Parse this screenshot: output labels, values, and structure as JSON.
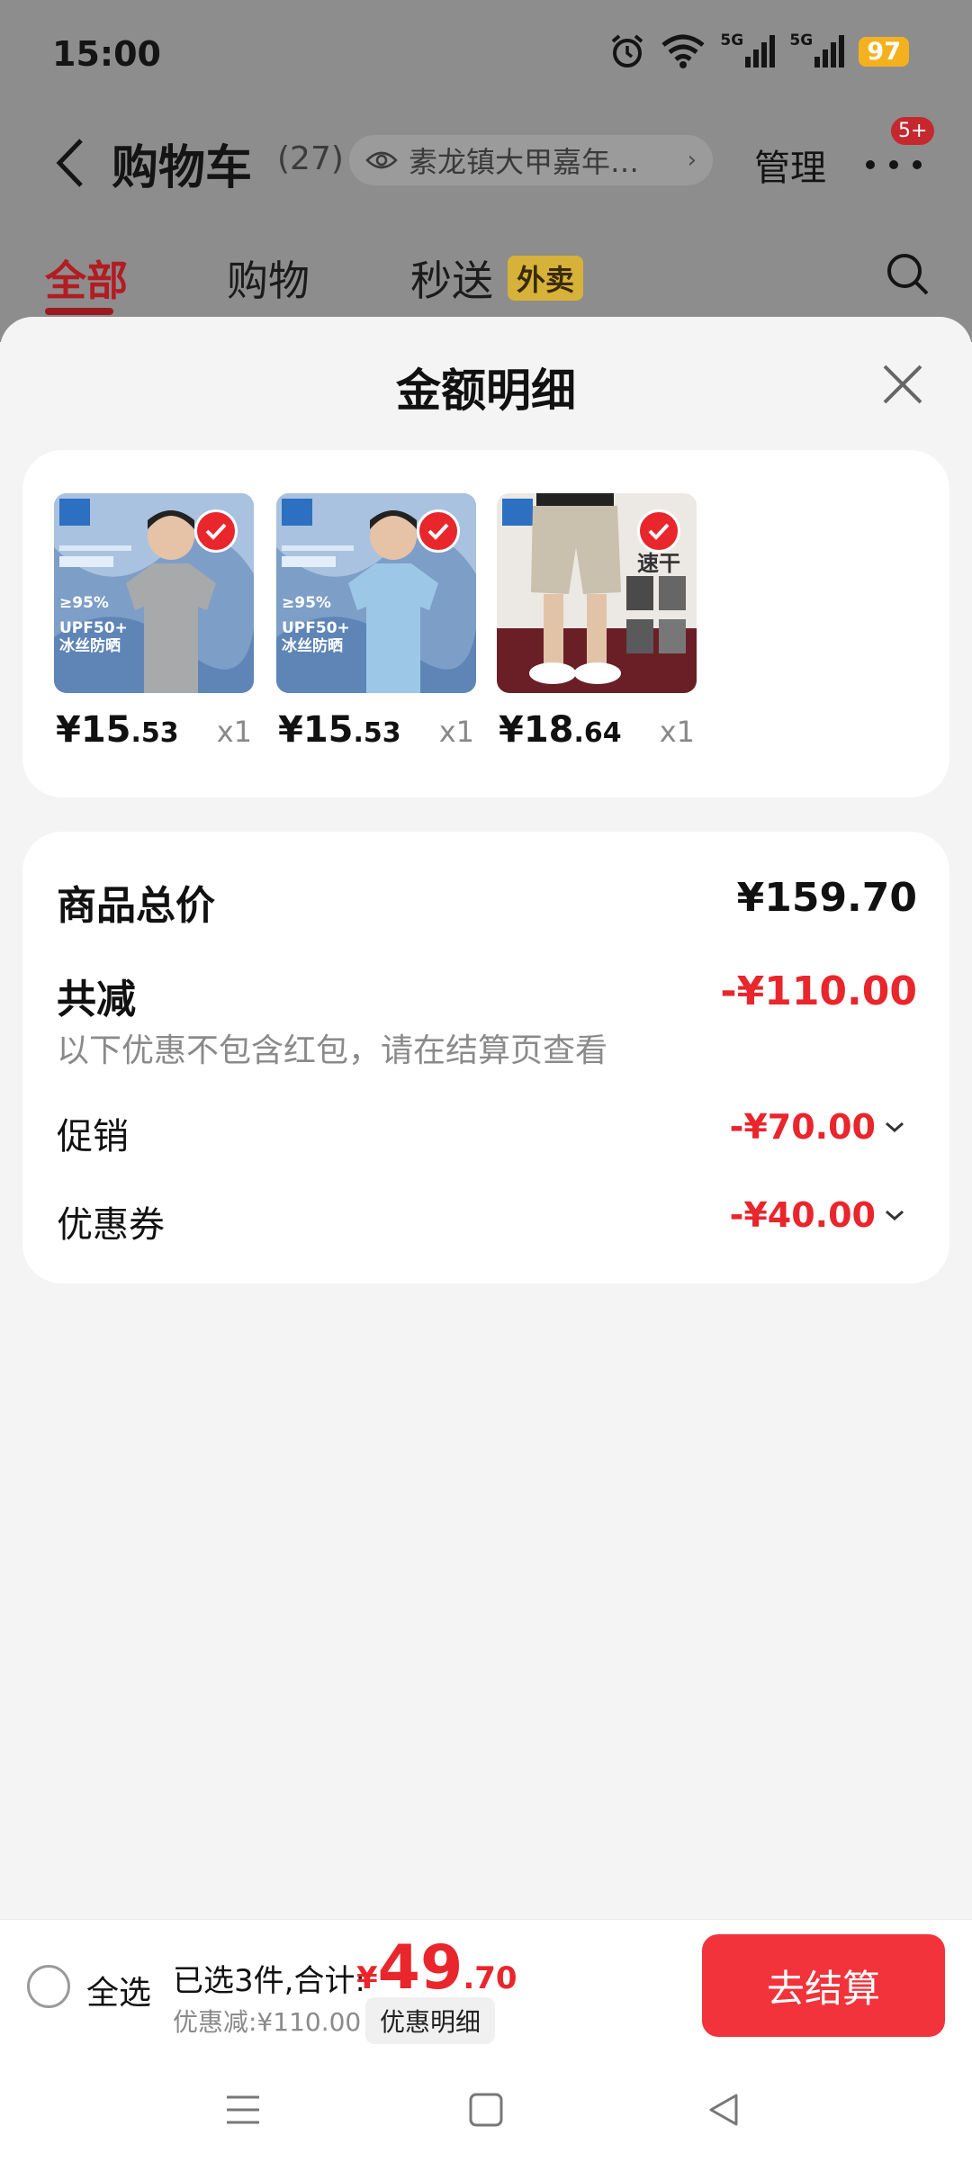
{
  "status_bar": {
    "time": "15:00",
    "battery": "97",
    "network1": "5G",
    "network2": "5G"
  },
  "nav": {
    "title": "购物车",
    "count": "(27)",
    "address": "素龙镇大甲嘉年…",
    "manage": "管理",
    "badge": "5+"
  },
  "tabs": [
    {
      "label": "全部",
      "active": true
    },
    {
      "label": "购物",
      "active": false
    },
    {
      "label": "秒送",
      "active": false
    }
  ],
  "tab_tag": "外卖",
  "sheet": {
    "title": "金额明细",
    "products": [
      {
        "price_int": "¥15",
        "price_dec": ".53",
        "qty": "x1",
        "image": "grey-tshirt",
        "promo": [
          "≥95%",
          "UPF50+",
          "冰丝防晒"
        ]
      },
      {
        "price_int": "¥15",
        "price_dec": ".53",
        "qty": "x1",
        "image": "blue-tshirt",
        "promo": [
          "≥95%",
          "UPF50+",
          "冰丝防晒"
        ]
      },
      {
        "price_int": "¥18",
        "price_dec": ".64",
        "qty": "x1",
        "image": "khaki-shorts",
        "promo": [
          "速干"
        ]
      }
    ],
    "summary": {
      "total_label": "商品总价",
      "total_value": "¥159.70",
      "reduce_label": "共减",
      "reduce_value": "-¥110.00",
      "note": "以下优惠不包含红包，请在结算页查看",
      "lines": [
        {
          "label": "促销",
          "value": "-¥70.00"
        },
        {
          "label": "优惠券",
          "value": "-¥40.00"
        }
      ]
    }
  },
  "bottom": {
    "select_all": "全选",
    "selected": "已选3件,合计:",
    "total_cur": "¥",
    "total_int": "49",
    "total_dec": ".70",
    "discount": "优惠减:¥110.00",
    "detail_btn": "优惠明细",
    "checkout": "去结算"
  },
  "colors": {
    "accent": "#e8262c",
    "checkout": "#f2333b",
    "overlay": "#8d8d8d"
  }
}
